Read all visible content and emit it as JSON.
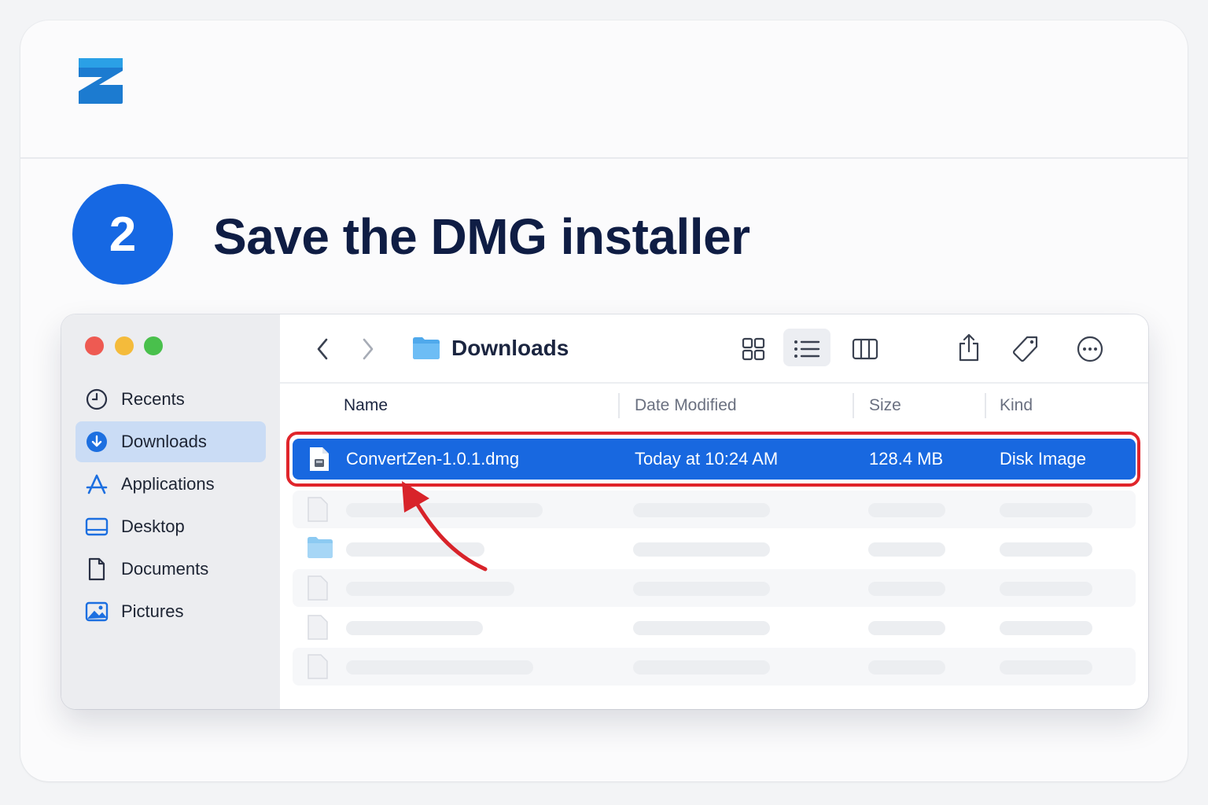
{
  "brand": {
    "logo_icon": "zen-logo-icon",
    "color": "#1668e3"
  },
  "step": {
    "number": "2",
    "title": "Save the DMG installer"
  },
  "finder": {
    "sidebar": {
      "items": [
        {
          "label": "Recents",
          "icon": "clock-icon"
        },
        {
          "label": "Downloads",
          "icon": "download-circle-icon",
          "active": true
        },
        {
          "label": "Applications",
          "icon": "applications-icon"
        },
        {
          "label": "Desktop",
          "icon": "desktop-icon"
        },
        {
          "label": "Documents",
          "icon": "document-icon"
        },
        {
          "label": "Pictures",
          "icon": "pictures-icon"
        }
      ]
    },
    "toolbar": {
      "title": "Downloads",
      "icons": [
        "back-icon",
        "forward-icon",
        "folder-icon",
        "grid-view-icon",
        "list-view-icon",
        "column-view-icon",
        "share-icon",
        "tag-icon",
        "more-icon"
      ]
    },
    "columns": {
      "name": "Name",
      "date": "Date Modified",
      "size": "Size",
      "kind": "Kind"
    },
    "selected_file": {
      "name": "ConvertZen-1.0.1.dmg",
      "date": "Today at 10:24 AM",
      "size": "128.4 MB",
      "kind": "Disk Image"
    },
    "accent_color": "#1868e0",
    "highlight_color": "#e0252b"
  }
}
